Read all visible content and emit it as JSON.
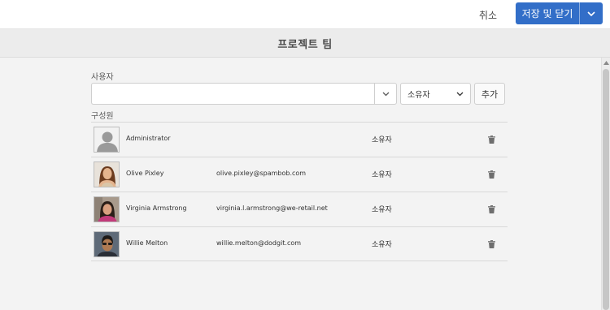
{
  "header": {
    "cancel_label": "취소",
    "save_label": "저장 및 닫기",
    "accent_color": "#326ec8"
  },
  "page": {
    "title": "프로젝트 팀"
  },
  "user_section": {
    "label": "사용자",
    "input_value": "",
    "input_placeholder": "",
    "role_selected": "소유자",
    "add_label": "추가"
  },
  "members_section": {
    "label": "구성원",
    "members": [
      {
        "name": "Administrator",
        "email": "",
        "role": "소유자",
        "avatar_icon": "default-user-icon"
      },
      {
        "name": "Olive Pixley",
        "email": "olive.pixley@spambob.com",
        "role": "소유자",
        "avatar_icon": "photo"
      },
      {
        "name": "Virginia Armstrong",
        "email": "virginia.l.armstrong@we-retail.net",
        "role": "소유자",
        "avatar_icon": "photo"
      },
      {
        "name": "Willie Melton",
        "email": "willie.melton@dodgit.com",
        "role": "소유자",
        "avatar_icon": "photo"
      }
    ]
  }
}
